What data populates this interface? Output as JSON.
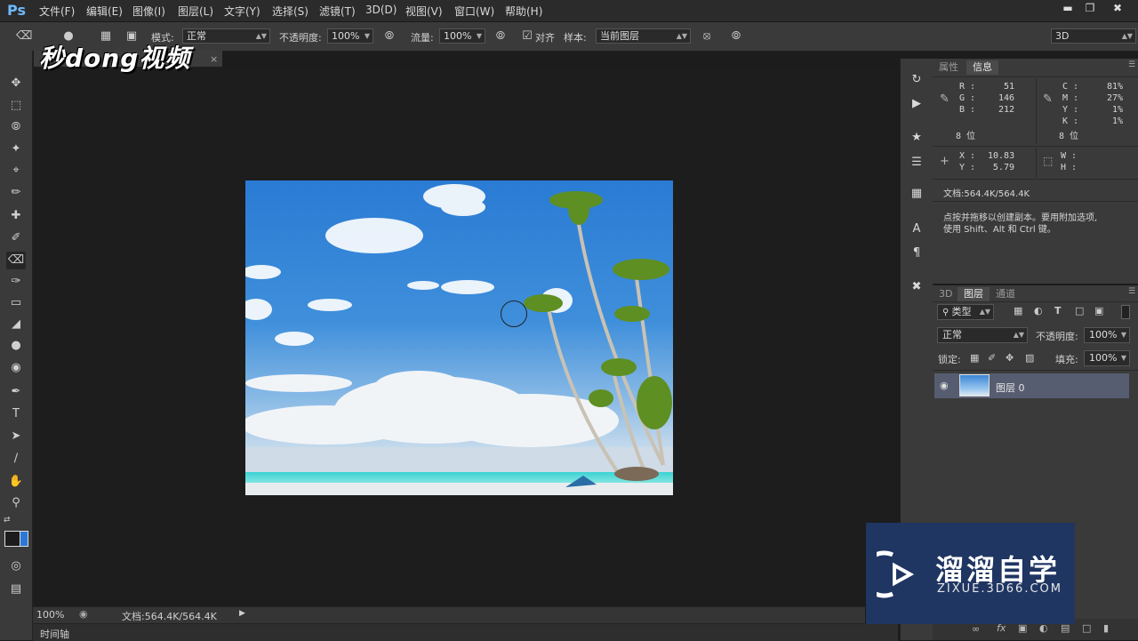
{
  "app": {
    "logo": "Ps",
    "menu": [
      "文件(F)",
      "编辑(E)",
      "图像(I)",
      "图层(L)",
      "文字(Y)",
      "选择(S)",
      "滤镜(T)",
      "3D(D)",
      "视图(V)",
      "窗口(W)",
      "帮助(H)"
    ],
    "window_controls": [
      "minimize-icon",
      "restore-icon",
      "close-icon"
    ]
  },
  "options": {
    "mode_label": "模式:",
    "mode_value": "正常",
    "opacity_label": "不透明度:",
    "opacity_value": "100%",
    "flow_label": "流量:",
    "flow_value": "100%",
    "align_checked": true,
    "align_label": "对齐",
    "sample_label": "样本:",
    "sample_value": "当前图层",
    "workspace_value": "3D"
  },
  "document": {
    "tab_close": "×",
    "overlay_brand": "秒dong视频"
  },
  "status": {
    "zoom": "100%",
    "doc_size": "文档:564.4K/564.4K",
    "timeline": "时间轴"
  },
  "info_panel": {
    "tabs": [
      "属性",
      "信息"
    ],
    "active_tab": "信息",
    "rgb": {
      "R": "51",
      "G": "146",
      "B": "212"
    },
    "cmyk": {
      "C": "81%",
      "M": "27%",
      "Y": "1%",
      "K": "1%"
    },
    "bit_depth_left": "8 位",
    "bit_depth_right": "8 位",
    "xy": {
      "X": "10.83",
      "Y": "5.79"
    },
    "wh": {
      "W": "",
      "H": ""
    },
    "doc_size": "文档:564.4K/564.4K",
    "hint_line1": "点按并拖移以创建副本。要用附加选项,",
    "hint_line2": "使用 Shift、Alt 和 Ctrl 键。"
  },
  "layers_panel": {
    "tabs": [
      "3D",
      "图层",
      "通道"
    ],
    "active_tab": "图层",
    "filter_kind": "类型",
    "blend_mode": "正常",
    "opacity_label": "不透明度:",
    "opacity_value": "100%",
    "lock_label": "锁定:",
    "fill_label": "填充:",
    "fill_value": "100%",
    "layers": [
      {
        "name": "图层 0",
        "visible": true
      }
    ]
  },
  "zixue_watermark": {
    "title": "溜溜自学",
    "url": "ZIXUE.3D66.COM"
  },
  "colors": {
    "foreground": "#1c1c1c",
    "background": "#2b78d6",
    "sky_top": "#2f7fd6",
    "layer_selected": "#565d70"
  }
}
